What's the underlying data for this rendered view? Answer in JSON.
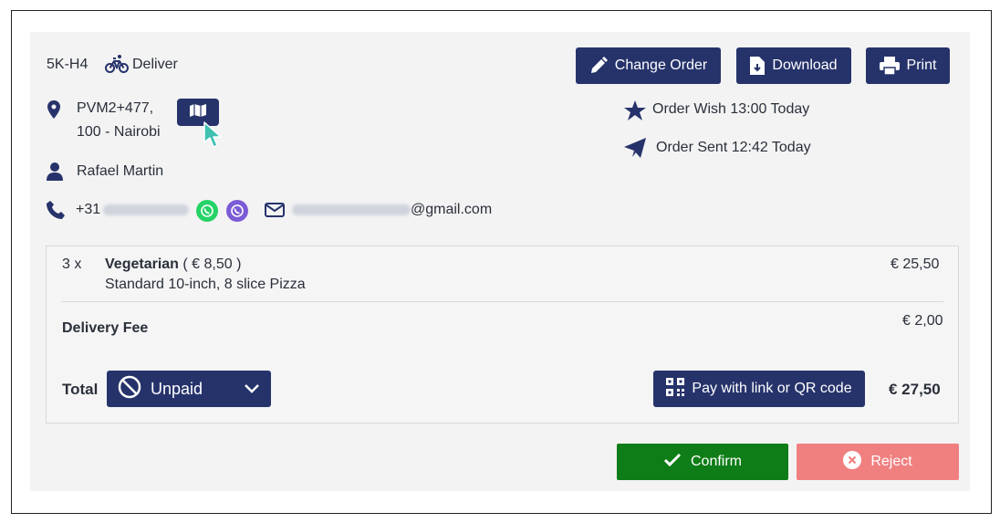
{
  "order": {
    "code": "5K-H4",
    "type_label": "Deliver"
  },
  "address": {
    "line1": "PVM2+477,",
    "line2": "100 - Nairobi"
  },
  "customer": {
    "name": "Rafael Martin",
    "phone_prefix": "+31",
    "email_suffix": "@gmail.com"
  },
  "toolbar": {
    "change_order": "Change Order",
    "download": "Download",
    "print": "Print"
  },
  "times": {
    "wish": "Order Wish 13:00 Today",
    "sent": "Order Sent 12:42 Today"
  },
  "items": [
    {
      "qty": "3 x",
      "name": "Vegetarian",
      "unit_price": "( € 8,50 )",
      "description": "Standard 10-inch, 8 slice Pizza",
      "total": "€ 25,50"
    }
  ],
  "delivery": {
    "label": "Delivery Fee",
    "amount": "€ 2,00"
  },
  "total": {
    "label": "Total",
    "status": "Unpaid",
    "pay_label": "Pay with link or QR code",
    "amount": "€ 27,50"
  },
  "actions": {
    "confirm": "Confirm",
    "reject": "Reject"
  },
  "colors": {
    "navy": "#26336b",
    "confirm": "#0f7d17",
    "reject": "#f08080",
    "whatsapp": "#25d366",
    "viber": "#7b5cd6"
  }
}
